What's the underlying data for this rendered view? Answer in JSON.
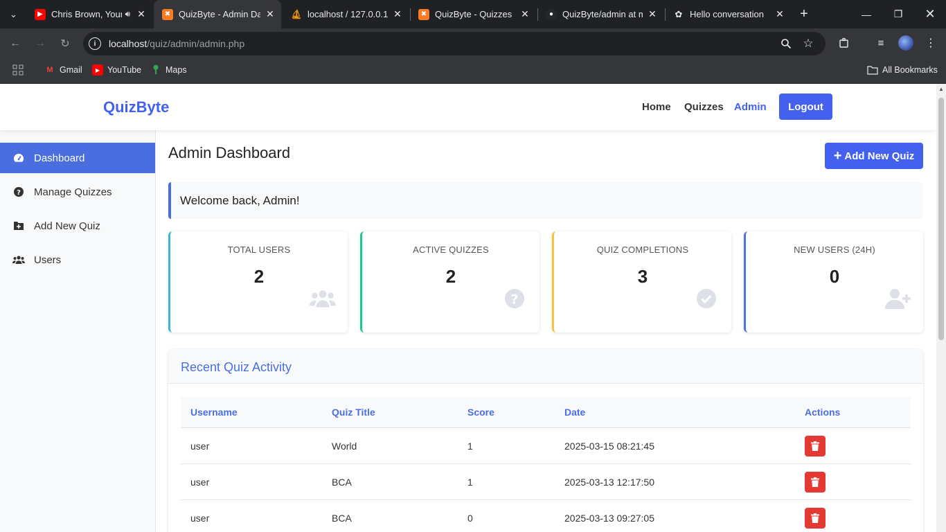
{
  "browser": {
    "tabs": [
      {
        "title": "Chris Brown, Your",
        "favicon": "youtube-icon",
        "audio": true,
        "active": false
      },
      {
        "title": "QuizByte - Admin Da",
        "favicon": "xampp-icon",
        "active": true
      },
      {
        "title": "localhost / 127.0.0.1 /",
        "favicon": "phpmyadmin-icon",
        "active": false
      },
      {
        "title": "QuizByte - Quizzes",
        "favicon": "xampp-icon",
        "active": false
      },
      {
        "title": "QuizByte/admin at m",
        "favicon": "github-icon",
        "active": false
      },
      {
        "title": "Hello conversation",
        "favicon": "chatgpt-icon",
        "active": false
      }
    ],
    "url_host": "localhost",
    "url_path": "/quiz/admin/admin.php",
    "bookmarks": [
      "Gmail",
      "YouTube",
      "Maps"
    ],
    "all_bookmarks": "All Bookmarks"
  },
  "header": {
    "brand": "QuizByte",
    "nav": {
      "home": "Home",
      "quizzes": "Quizzes",
      "admin": "Admin"
    },
    "logout": "Logout"
  },
  "sidebar": {
    "items": [
      {
        "label": "Dashboard",
        "icon": "dashboard-icon",
        "active": true
      },
      {
        "label": "Manage Quizzes",
        "icon": "question-circle-icon"
      },
      {
        "label": "Add New Quiz",
        "icon": "folder-plus-icon"
      },
      {
        "label": "Users",
        "icon": "users-icon"
      }
    ]
  },
  "main": {
    "title": "Admin Dashboard",
    "add_button": "Add New Quiz",
    "welcome": "Welcome back, Admin!",
    "stats": [
      {
        "label": "TOTAL USERS",
        "value": "2",
        "color": "#36b9cc",
        "icon": "users-icon"
      },
      {
        "label": "ACTIVE QUIZZES",
        "value": "2",
        "color": "#1cc88a",
        "icon": "question-circle-icon"
      },
      {
        "label": "QUIZ COMPLETIONS",
        "value": "3",
        "color": "#f6c23e",
        "icon": "check-circle-icon"
      },
      {
        "label": "NEW USERS (24H)",
        "value": "0",
        "color": "#4e73df",
        "icon": "user-plus-icon"
      }
    ],
    "activity": {
      "title": "Recent Quiz Activity",
      "columns": [
        "Username",
        "Quiz Title",
        "Score",
        "Date",
        "Actions"
      ],
      "rows": [
        {
          "username": "user",
          "quiz": "World",
          "score": "1",
          "date": "2025-03-15 08:21:45"
        },
        {
          "username": "user",
          "quiz": "BCA",
          "score": "1",
          "date": "2025-03-13 12:17:50"
        },
        {
          "username": "user",
          "quiz": "BCA",
          "score": "0",
          "date": "2025-03-13 09:27:05"
        }
      ]
    }
  },
  "colors": {
    "primary": "#4361ee",
    "sidebar_active": "#4a6ee0",
    "danger": "#e53935"
  }
}
